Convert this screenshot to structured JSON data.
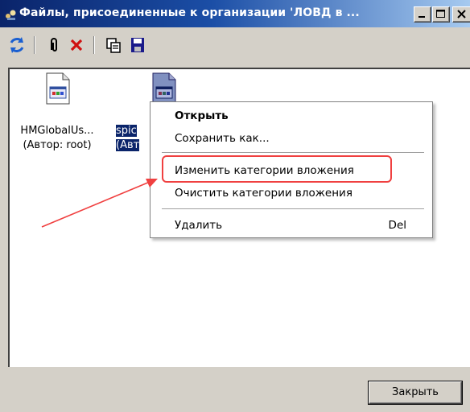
{
  "window": {
    "title": "Файлы, присоединенные к организации 'ЛОВД в ..."
  },
  "toolbar": {
    "buttons": [
      "refresh-icon",
      "paperclip-icon",
      "delete-icon",
      "copy-icon",
      "save-icon"
    ]
  },
  "files": [
    {
      "name_line1": "HMGlobalUs...",
      "name_line2": "(Автор: root)",
      "selected": false
    },
    {
      "name_line1": "spic",
      "name_line2": "(Авт",
      "selected": true
    }
  ],
  "context_menu": {
    "open": "Открыть",
    "save_as": "Сохранить как...",
    "change_categories": "Изменить категории вложения",
    "clear_categories": "Очистить категории вложения",
    "delete": "Удалить",
    "delete_shortcut": "Del"
  },
  "footer": {
    "close_label": "Закрыть"
  },
  "colors": {
    "title_start": "#0a246a",
    "title_end": "#a6caf0",
    "selection": "#0a246a",
    "annotation": "#f04040"
  }
}
